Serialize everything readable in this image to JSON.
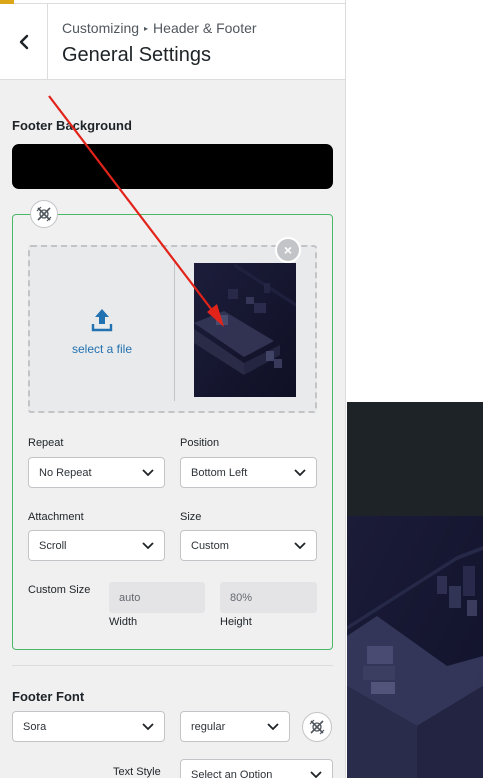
{
  "header": {
    "breadcrumb_root": "Customizing",
    "breadcrumb_separator": "▸",
    "breadcrumb_section": "Header & Footer",
    "title": "General Settings",
    "back_icon": "chevron-left-icon"
  },
  "footer_background": {
    "label": "Footer Background",
    "color": "#000000",
    "select_file": "select a file",
    "upload_icon": "upload-icon",
    "remove_icon": "close-icon",
    "reset_icon": "reset-icon",
    "repeat": {
      "label": "Repeat",
      "value": "No Repeat"
    },
    "position": {
      "label": "Position",
      "value": "Bottom Left"
    },
    "attachment": {
      "label": "Attachment",
      "value": "Scroll"
    },
    "size": {
      "label": "Size",
      "value": "Custom"
    },
    "custom_size": {
      "label": "Custom Size",
      "width_value": "auto",
      "width_label": "Width",
      "height_value": "80%",
      "height_label": "Height"
    }
  },
  "footer_font": {
    "label": "Footer Font",
    "family": "Sora",
    "variant": "regular",
    "text_style_label": "Text Style",
    "text_style_value": "Select an Option"
  },
  "colors": {
    "accent": "#2271b1",
    "active_border": "#4ab866",
    "annotation_arrow": "#e2231a",
    "preview_bg": "#1d2327"
  }
}
